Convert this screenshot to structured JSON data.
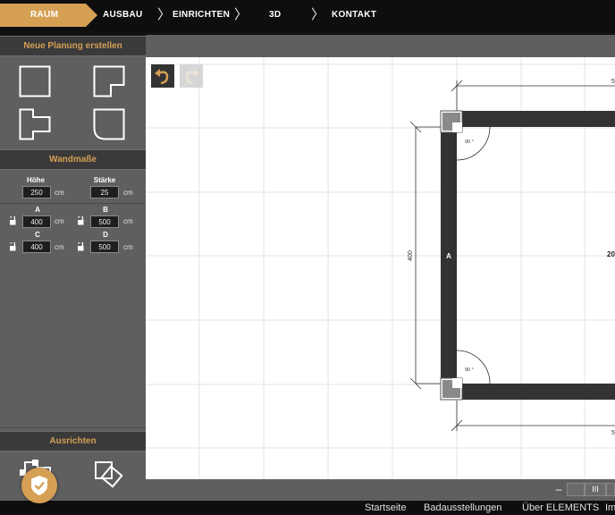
{
  "nav": {
    "steps": [
      {
        "label": "RAUM",
        "active": true
      },
      {
        "label": "AUSBAU",
        "active": false
      },
      {
        "label": "EINRICHTEN",
        "active": false
      },
      {
        "label": "3D",
        "active": false
      },
      {
        "label": "KONTAKT",
        "active": false
      }
    ]
  },
  "sidebar": {
    "new_plan_title": "Neue Planung erstellen",
    "shapes": [
      "rectangle-shape-icon",
      "l-shape-icon",
      "t-shape-icon",
      "cut-corner-shape-icon"
    ],
    "wall_title": "Wandmaße",
    "hoehe": {
      "label": "Höhe",
      "value": "250",
      "unit": "cm"
    },
    "staerke": {
      "label": "Stärke",
      "value": "25",
      "unit": "cm"
    },
    "walls": [
      {
        "label": "A",
        "value": "400",
        "unit": "cm"
      },
      {
        "label": "B",
        "value": "500",
        "unit": "cm"
      },
      {
        "label": "C",
        "value": "400",
        "unit": "cm"
      },
      {
        "label": "D",
        "value": "500",
        "unit": "cm"
      }
    ],
    "align_title": "Ausrichten"
  },
  "plan": {
    "wall_label": "A",
    "dim_left": "400",
    "dim_top": "5",
    "dim_bottom": "5",
    "room_area": "20",
    "angle_top": "90 °",
    "angle_bottom": "90 °"
  },
  "zoom": {
    "out_label": "–",
    "level_label": "III"
  },
  "footer": {
    "links": [
      "Startseite",
      "Badausstellungen",
      "Über ELEMENTS",
      "Im"
    ]
  },
  "colors": {
    "accent": "#d59f54",
    "wall": "#333333",
    "panel": "#5f5f5f",
    "header": "#3a3a3a"
  }
}
